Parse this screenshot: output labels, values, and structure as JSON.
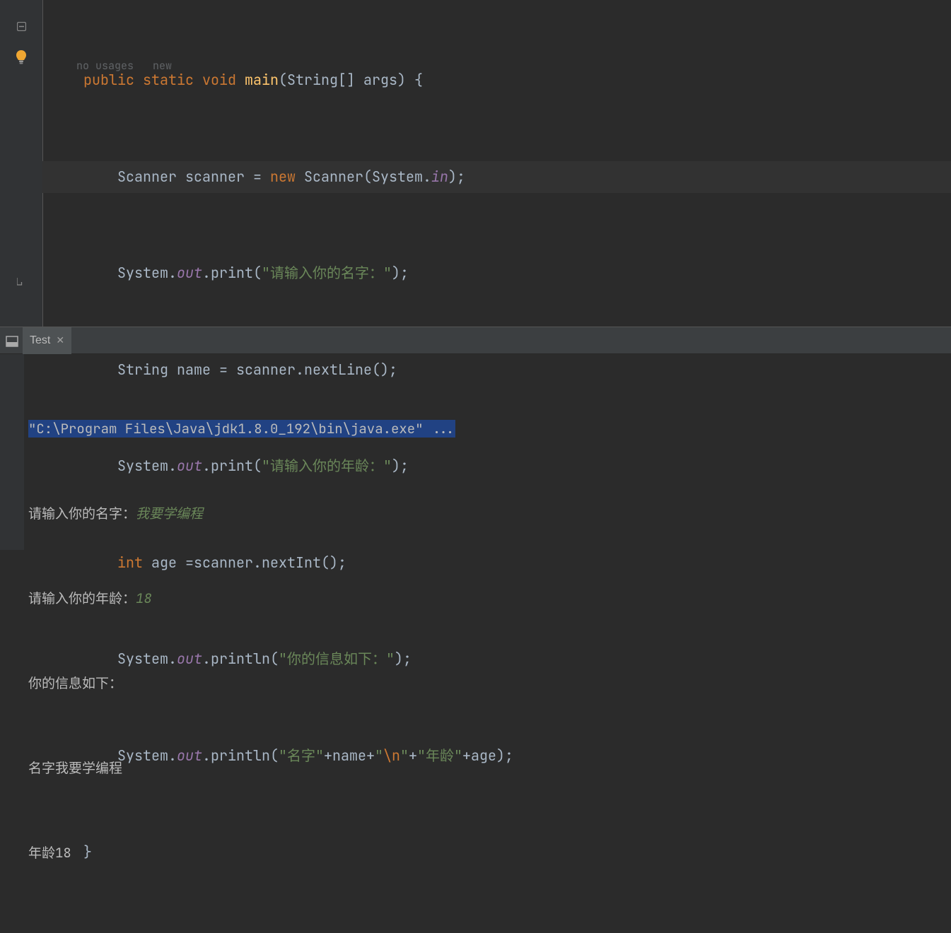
{
  "editor": {
    "topHint": "no usages   new",
    "lines": {
      "l0_main": {
        "public": "public",
        "static": "static",
        "void": "void",
        "main": "main",
        "params": "(String[] args) {"
      },
      "l1": {
        "scannerDecl": "Scanner scanner = ",
        "new": "new",
        "rest": " Scanner(System.",
        "in": "in",
        "tail": ");"
      },
      "l2": {
        "sys": "System.",
        "out": "out",
        "print": ".print(",
        "str": "\"请输入你的名字：\"",
        "tail": ");"
      },
      "l3": {
        "text": "String name = scanner.nextLine();"
      },
      "l4": {
        "sys": "System.",
        "out": "out",
        "print": ".print(",
        "str": "\"请输入你的年龄：\"",
        "tail": ");"
      },
      "l5": {
        "int": "int",
        "rest": " age =scanner.nextInt();"
      },
      "l6": {
        "sys": "System.",
        "out": "out",
        "print": ".println(",
        "str": "\"你的信息如下：\"",
        "tail": ");"
      },
      "l7": {
        "sys": "System.",
        "out": "out",
        "print": ".println(",
        "s1": "\"名字\"",
        "plus1": "+name+",
        "s2": "\"",
        "esc": "\\n",
        "s2b": "\"",
        "plus2": "+",
        "s3": "\"年龄\"",
        "plus3": "+age);"
      },
      "l8": {
        "brace": "}"
      }
    }
  },
  "console": {
    "tabName": "Test",
    "cmd": "\"C:\\Program Files\\Java\\jdk1.8.0_192\\bin\\java.exe\" ...",
    "lines": {
      "p1": {
        "prompt": "请输入你的名字：",
        "input": "我要学编程"
      },
      "p2": {
        "prompt": "请输入你的年龄：",
        "input": "18"
      },
      "p3": "你的信息如下：",
      "p4": "名字我要学编程",
      "p5": "年龄18"
    }
  }
}
